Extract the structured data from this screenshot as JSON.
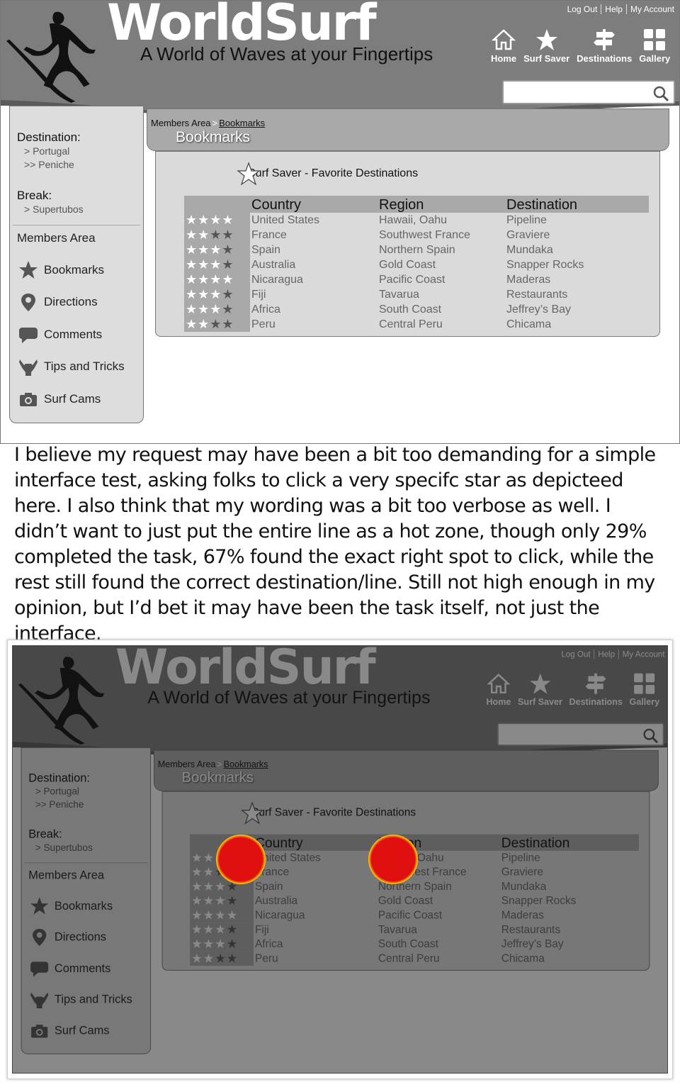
{
  "header": {
    "brand": "WorldSurf",
    "tagline": "A World of Waves at your Fingertips",
    "util_links": [
      "Log Out",
      "Help",
      "My Account"
    ],
    "nav": [
      {
        "label": "Home",
        "icon": "home-icon"
      },
      {
        "label": "Surf Saver",
        "icon": "star-icon"
      },
      {
        "label": "Destinations",
        "icon": "signpost-icon"
      },
      {
        "label": "Gallery",
        "icon": "grid-icon"
      }
    ],
    "search_placeholder": ""
  },
  "sidebar": {
    "destination_label": "Destination:",
    "destination_path": [
      "> Portugal",
      ">> Peniche"
    ],
    "break_label": "Break:",
    "break_path": [
      "> Supertubos"
    ],
    "members_title": "Members Area",
    "items": [
      {
        "label": "Bookmarks",
        "icon": "star-icon"
      },
      {
        "label": "Directions",
        "icon": "map-pin-icon"
      },
      {
        "label": "Comments",
        "icon": "speech-bubble-icon"
      },
      {
        "label": "Tips and Tricks",
        "icon": "shaka-hand-icon"
      },
      {
        "label": "Surf Cams",
        "icon": "camera-icon"
      }
    ]
  },
  "breadcrumb": {
    "parent": "Members Area",
    "separator": ">",
    "current": "Bookmarks"
  },
  "page_title": "Bookmarks",
  "panel_title": "Surf Saver - Favorite Destinations",
  "table": {
    "headers": [
      "Country",
      "Region",
      "Destination"
    ],
    "rows": [
      {
        "rating": 4,
        "country": "United States",
        "region": "Hawaii, Oahu",
        "destination": "Pipeline"
      },
      {
        "rating": 2,
        "country": "France",
        "region": "Southwest France",
        "destination": "Graviere"
      },
      {
        "rating": 3,
        "country": "Spain",
        "region": "Northern Spain",
        "destination": "Mundaka"
      },
      {
        "rating": 3,
        "country": "Australia",
        "region": "Gold Coast",
        "destination": "Snapper Rocks"
      },
      {
        "rating": 4,
        "country": "Nicaragua",
        "region": "Pacific Coast",
        "destination": "Maderas"
      },
      {
        "rating": 3,
        "country": "Fiji",
        "region": "Tavarua",
        "destination": "Restaurants"
      },
      {
        "rating": 3,
        "country": "Africa",
        "region": "South Coast",
        "destination": "Jeffrey’s Bay"
      },
      {
        "rating": 2,
        "country": "Peru",
        "region": "Central Peru",
        "destination": "Chicama"
      }
    ],
    "max_rating": 4
  },
  "commentary": "I believe my request may have been a bit too demanding for a simple interface test, asking folks to click a very specifc star as depicteed here. I also think that my wording was a bit too verbose as well. I didn’t want to just put the entire line as a hot zone, though only 29% completed the task, 67% found the exact right spot to click, while the rest still found the correct destination/line. Still not high enough in my opinion, but I’d bet it may have been the task itself, not just the interface.",
  "colors": {
    "header_gray": "#7a7a7a",
    "panel_gray": "#dadada",
    "bar_gray": "#a9a9a9",
    "heat_red": "#e01010"
  }
}
